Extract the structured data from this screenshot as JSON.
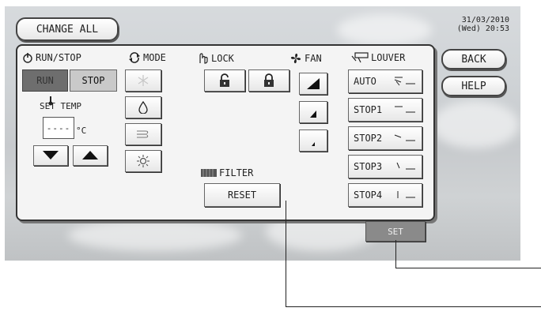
{
  "header": {
    "change_all_label": "CHANGE ALL",
    "date": "31/03/2010",
    "day_time": "(Wed) 20:53"
  },
  "side": {
    "back_label": "BACK",
    "help_label": "HELP"
  },
  "run_stop": {
    "title": "RUN/STOP",
    "run_label": "RUN",
    "stop_label": "STOP",
    "set_temp_label": "SET TEMP",
    "temp_value": "----",
    "temp_unit": "°C",
    "selected": "RUN"
  },
  "mode": {
    "title": "MODE",
    "items": [
      {
        "icon": "snowflake-icon",
        "enabled": false
      },
      {
        "icon": "droplet-icon",
        "enabled": true
      },
      {
        "icon": "fan-wind-icon",
        "enabled": true
      },
      {
        "icon": "sun-icon",
        "enabled": true
      }
    ]
  },
  "lock": {
    "title": "LOCK",
    "items": [
      {
        "icon": "unlock-icon"
      },
      {
        "icon": "lock-icon"
      }
    ]
  },
  "fan": {
    "title": "FAN",
    "levels": [
      {
        "icon": "fan-high-icon"
      },
      {
        "icon": "fan-medium-icon"
      },
      {
        "icon": "fan-low-icon"
      }
    ]
  },
  "filter": {
    "title": "FILTER",
    "reset_label": "RESET"
  },
  "louver": {
    "title": "LOUVER",
    "items": [
      {
        "label": "AUTO",
        "icon": "louver-auto-icon"
      },
      {
        "label": "STOP1",
        "icon": "louver-stop1-icon"
      },
      {
        "label": "STOP2",
        "icon": "louver-stop2-icon"
      },
      {
        "label": "STOP3",
        "icon": "louver-stop3-icon"
      },
      {
        "label": "STOP4",
        "icon": "louver-stop4-icon"
      }
    ]
  },
  "footer": {
    "set_label": "SET"
  },
  "colors": {
    "panel_bg": "#f4f4f4",
    "run_active": "#6e6e6e",
    "set_button": "#8a8a8a"
  }
}
